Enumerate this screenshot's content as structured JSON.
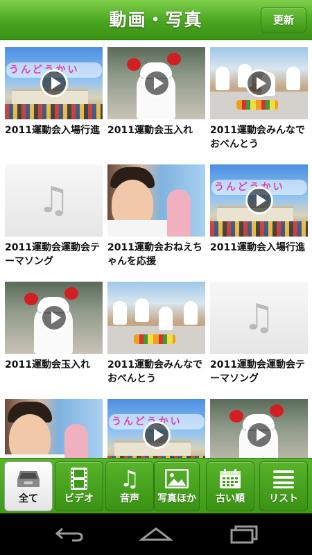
{
  "header": {
    "title": "動画・写真",
    "refresh_label": "更新"
  },
  "grid": {
    "items": [
      {
        "caption": "2011運動会入場行進",
        "type": "video",
        "thumb": "sports-day-banner"
      },
      {
        "caption": "2011運動会玉入れ",
        "type": "video",
        "thumb": "ball-toss"
      },
      {
        "caption": "2011運動会みんなでおべんとう",
        "type": "video",
        "thumb": "picnic-lunch"
      },
      {
        "caption": "2011運動会運動会テーマソング",
        "type": "audio",
        "thumb": "music-note-icon"
      },
      {
        "caption": "2011運動会おねえちゃんを応援",
        "type": "photo",
        "thumb": "cheering-sister"
      },
      {
        "caption": "2011運動会入場行進",
        "type": "video",
        "thumb": "sports-day-banner"
      },
      {
        "caption": "2011運動会玉入れ",
        "type": "video",
        "thumb": "ball-toss"
      },
      {
        "caption": "2011運動会みんなでおべんとう",
        "type": "photo",
        "thumb": "picnic-lunch"
      },
      {
        "caption": "2011運動会運動会テーマソング",
        "type": "audio",
        "thumb": "music-note-icon"
      },
      {
        "caption": "",
        "type": "photo",
        "thumb": "cheering-sister"
      },
      {
        "caption": "",
        "type": "video",
        "thumb": "sports-day-banner"
      },
      {
        "caption": "",
        "type": "video",
        "thumb": "ball-toss"
      }
    ],
    "banner_text": "うんどうかい"
  },
  "tabs": [
    {
      "label": "全て",
      "icon": "tray-icon",
      "active": true
    },
    {
      "label": "ビデオ",
      "icon": "film-icon",
      "active": false
    },
    {
      "label": "音声",
      "icon": "music-note-icon",
      "active": false
    },
    {
      "label": "写真ほか",
      "icon": "picture-icon",
      "active": false
    },
    {
      "label": "古い順",
      "icon": "calendar-icon",
      "active": false
    },
    {
      "label": "リスト",
      "icon": "list-icon",
      "active": false
    }
  ],
  "nav": {
    "back": "back-icon",
    "home": "home-icon",
    "recents": "recents-icon"
  },
  "colors": {
    "header_green": "#49a51f",
    "tab_green": "#3e9a18",
    "active_tab": "#ffffff",
    "nav_black": "#000000"
  }
}
